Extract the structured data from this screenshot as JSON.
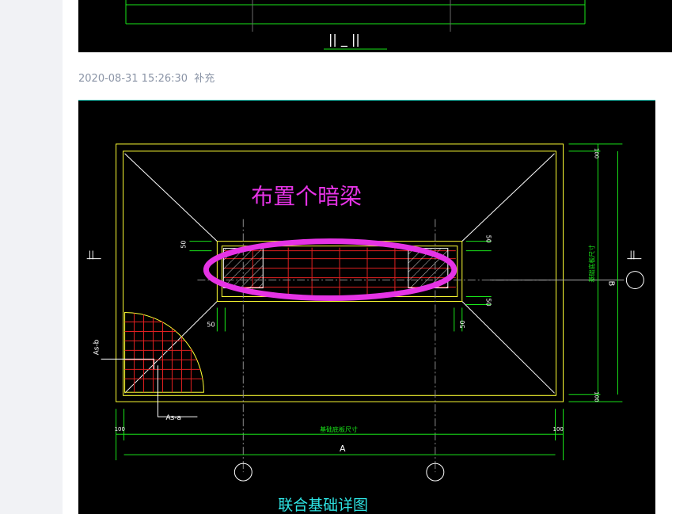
{
  "reply": {
    "timestamp": "2020-08-31 15:26:30",
    "type_label": "补充"
  },
  "drawing_top": {
    "section_mark": "||  _  ||"
  },
  "drawing_main": {
    "annotation": "布置个暗梁",
    "caption": "联合基础详图",
    "dim_100": "100",
    "dim_50": "50",
    "label_a": "A",
    "label_b": "B",
    "label_as_b": "As-b",
    "label_as_a": "As-a",
    "section_mark": "||",
    "dim_caption_h": "基础底板尺寸",
    "dim_caption_v": "基础底板尺寸"
  },
  "colors": {
    "cad_bg": "#000000",
    "outline_yellow": "#ffff33",
    "dim_green": "#19e619",
    "rebar_red": "#e02020",
    "annotation_magenta": "#e533e5",
    "caption_cyan": "#2ee6e6",
    "meta_gray": "#8a94a6"
  }
}
